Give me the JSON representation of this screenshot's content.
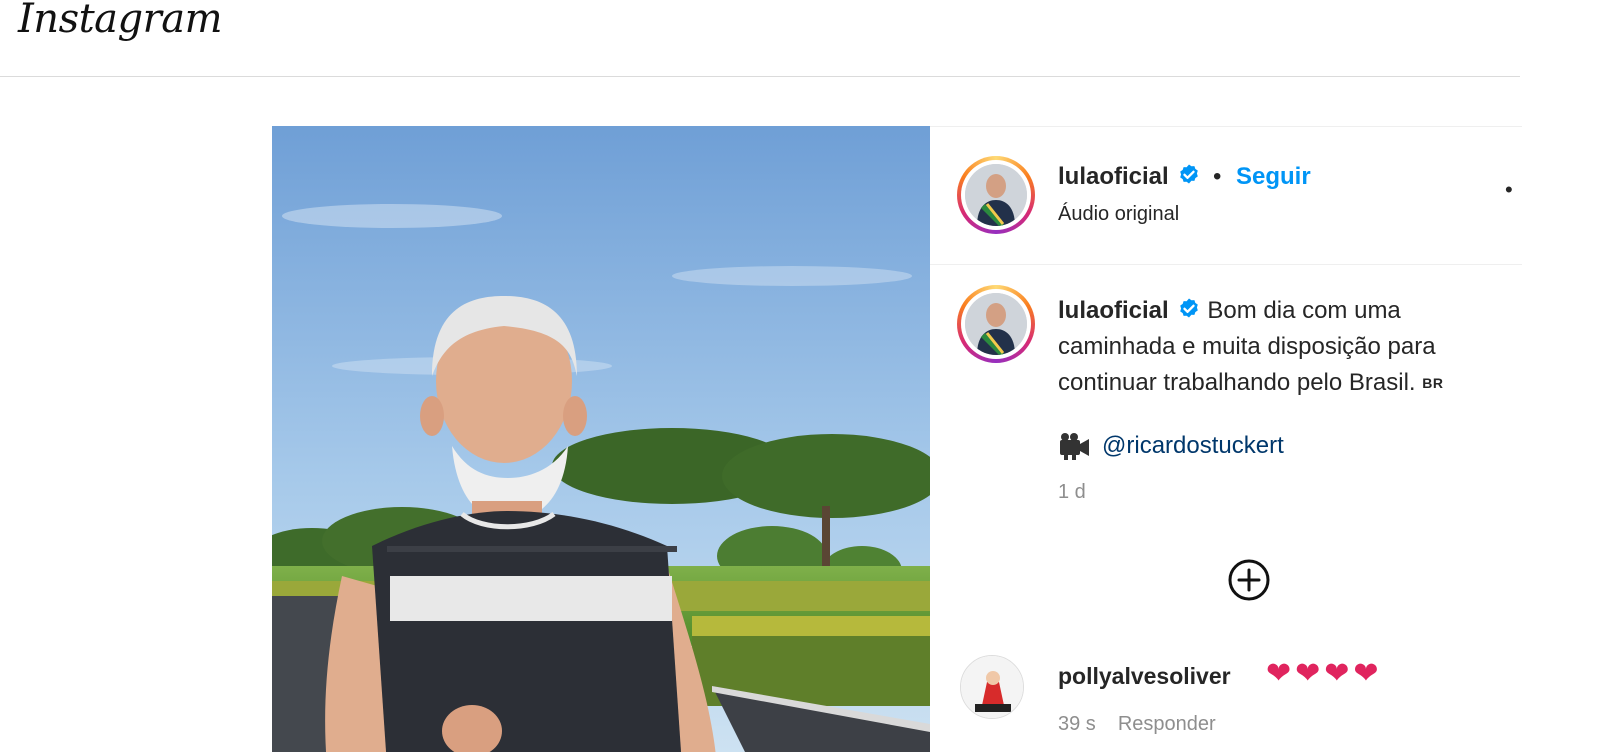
{
  "app": {
    "logo": "Instagram"
  },
  "post": {
    "author": {
      "username": "lulaoficial",
      "verified": true,
      "follow_label": "Seguir",
      "separator": "•",
      "audio_label": "Áudio original"
    },
    "more_icon": "•",
    "caption": {
      "username": "lulaoficial",
      "text": "Bom dia com uma caminhada e muita disposição para continuar trabalhando pelo Brasil.",
      "flag": "BR"
    },
    "mention": "@ricardostuckert",
    "time_ago": "1 d",
    "load_more_icon": "plus-circle-icon"
  },
  "comments": [
    {
      "username": "pollyalvesoliver",
      "hearts": [
        "❤",
        "❤",
        "❤",
        "❤"
      ],
      "time": "39 s",
      "reply_label": "Responder"
    }
  ],
  "colors": {
    "accent": "#0095f6",
    "verified": "#0095f6",
    "link": "#00376b",
    "muted": "#8e8e8e",
    "heart": "#e0245e"
  }
}
